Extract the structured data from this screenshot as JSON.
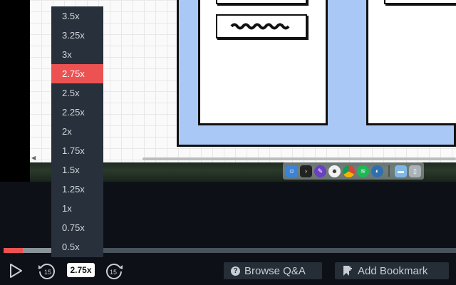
{
  "video": {
    "dock_icons": [
      "finder-icon",
      "terminal-icon",
      "pen-app-icon",
      "smiley-app-icon",
      "chrome-icon",
      "spotify-icon",
      "network-app-icon",
      "folder-icon",
      "trash-icon"
    ]
  },
  "speed_menu": {
    "options": [
      "3.5x",
      "3.25x",
      "3x",
      "2.75x",
      "2.5x",
      "2.25x",
      "2x",
      "1.75x",
      "1.5x",
      "1.25x",
      "1x",
      "0.75x",
      "0.5x"
    ],
    "selected": "2.75x"
  },
  "progress": {
    "played_fraction": 0.043,
    "hover_start_fraction": 0.043,
    "hover_end_fraction": 0.105
  },
  "controls": {
    "rewind_seconds": "15",
    "forward_seconds": "15",
    "rate_label": "2.75x",
    "browse_qa_label": "Browse Q&A",
    "add_bookmark_label": "Add Bookmark"
  },
  "colors": {
    "accent": "#ec5252",
    "menu_bg": "#27303b",
    "bar_bg": "#0d1117",
    "pill_bg": "#252d37"
  }
}
